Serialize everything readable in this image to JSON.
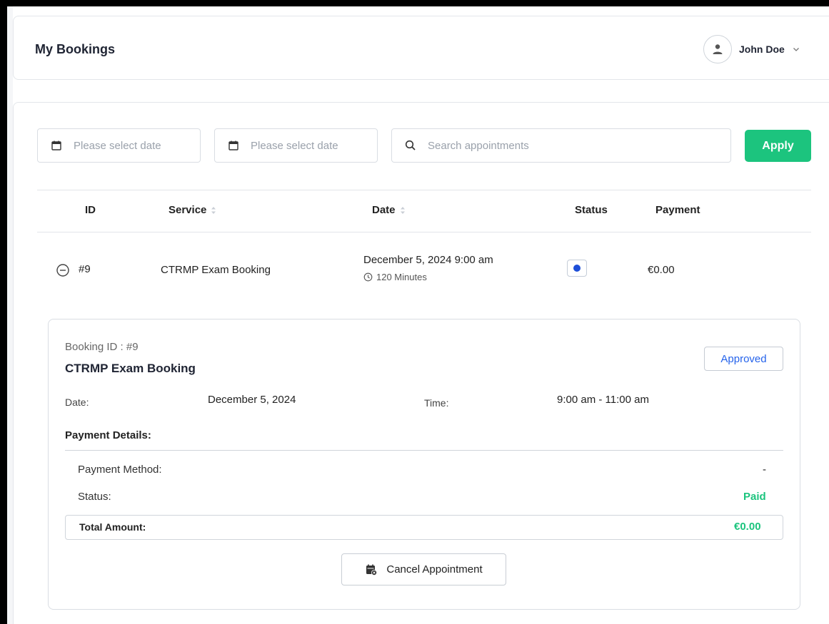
{
  "header": {
    "title": "My Bookings",
    "user_name": "John Doe"
  },
  "filters": {
    "start_date_placeholder": "Please select date",
    "end_date_placeholder": "Please select date",
    "search_placeholder": "Search appointments",
    "apply_label": "Apply"
  },
  "table": {
    "columns": [
      "ID",
      "Service",
      "Date",
      "Status",
      "Payment"
    ],
    "rows": [
      {
        "id": "#9",
        "service": "CTRMP Exam Booking",
        "date": "December 5, 2024 9:00 am",
        "duration": "120 Minutes",
        "payment": "€0.00",
        "status_color": "#1d4ed8"
      }
    ]
  },
  "details": {
    "booking_id_label": "Booking ID : #9",
    "service": "CTRMP Exam Booking",
    "status_badge": "Approved",
    "date_label": "Date:",
    "date_value": "December 5, 2024",
    "time_label": "Time:",
    "time_value": "9:00 am - 11:00 am",
    "payment_details_label": "Payment Details:",
    "payment_method_label": "Payment Method:",
    "payment_method_value": "-",
    "payment_status_label": "Status:",
    "payment_status_value": "Paid",
    "total_label": "Total Amount:",
    "total_value": "€0.00",
    "cancel_label": "Cancel Appointment"
  },
  "colors": {
    "accent_green": "#1cc47e",
    "approved_blue": "#2563eb"
  },
  "icons": {
    "avatar": "user-icon",
    "calendar": "calendar-icon",
    "search": "search-icon",
    "collapse": "minus-circle-icon",
    "clock": "clock-icon",
    "cancel": "calendar-x-icon"
  }
}
